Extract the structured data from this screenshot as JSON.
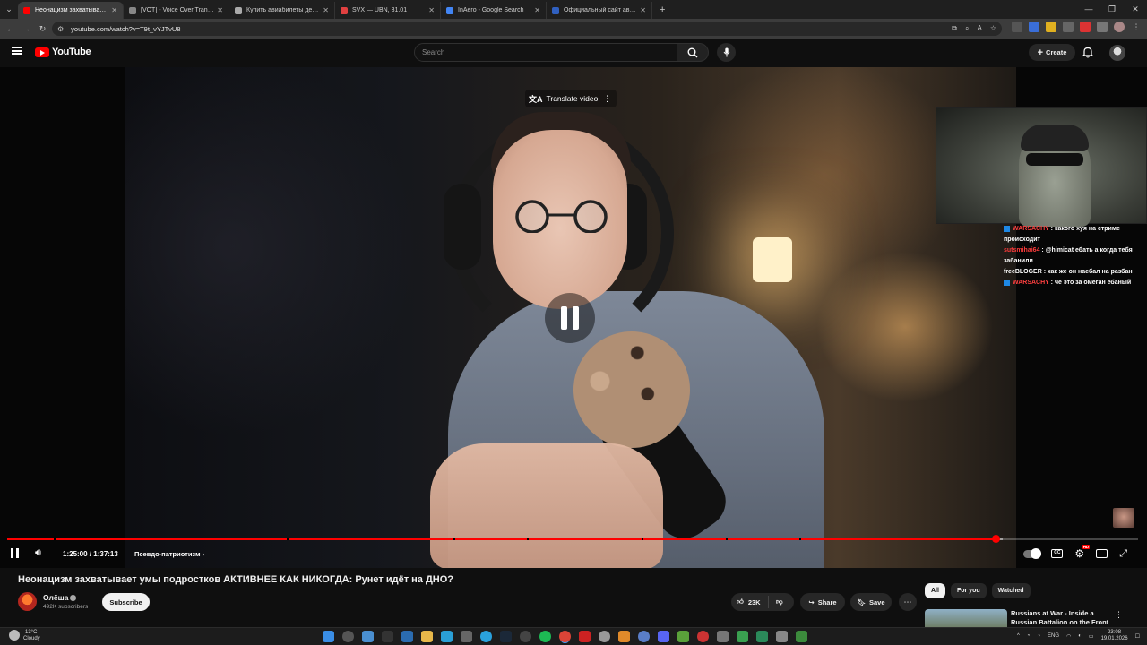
{
  "browser": {
    "tabs": [
      {
        "title": "Неонацизм захватывает у",
        "active": true,
        "color": "#ff0000"
      },
      {
        "title": "[VOT] - Voice Over Translation",
        "active": false,
        "color": "#888888"
      },
      {
        "title": "Купить авиабилеты дешево о",
        "active": false,
        "color": "#aaaaaa"
      },
      {
        "title": "SVX — UBN, 31.01",
        "active": false,
        "color": "#e04040"
      },
      {
        "title": "InAero - Google Search",
        "active": false,
        "color": "#4285f4"
      },
      {
        "title": "Официальный сайт авиакомп",
        "active": false,
        "color": "#3060c0"
      }
    ],
    "url": "youtube.com/watch?v=T9t_vYJTvU8"
  },
  "header": {
    "logo_text": "YouTube",
    "search_placeholder": "Search",
    "create_label": "Create"
  },
  "video": {
    "translate_label": "Translate video",
    "chat": [
      {
        "user": "WARSACHY",
        "text": " : какого хуя на стриме происходит"
      },
      {
        "user": "sutsmihai64",
        "text": " : @himicat ебать а когда тебя забанили"
      },
      {
        "user": "freeBLOGER",
        "text": " : как же он наебал на разбан"
      },
      {
        "user": "WARSACHY",
        "text": " : че это за омеган ебаный"
      }
    ],
    "time_current": "1:25:00",
    "time_separator": " / ",
    "time_total": "1:37:13",
    "chapter": "Псевдо-патриотизм",
    "progress_fraction": 0.874
  },
  "meta": {
    "title": "Неонацизм захватывает умы подростков АКТИВНЕЕ КАК НИКОГДА: Рунет идёт на ДНО?",
    "channel_name": "Олёша",
    "subscribers": "492K subscribers",
    "subscribe_label": "Subscribe",
    "likes": "23K",
    "share_label": "Share",
    "save_label": "Save"
  },
  "sidebar": {
    "chips": [
      "All",
      "For you",
      "Watched"
    ],
    "rec_title": "Russians at War - Inside a Russian Battalion on the Front"
  },
  "taskbar": {
    "temp": "-13°C",
    "condition": "Cloudy",
    "lang": "ENG",
    "time": "23:08",
    "date": "19.01.2026"
  }
}
